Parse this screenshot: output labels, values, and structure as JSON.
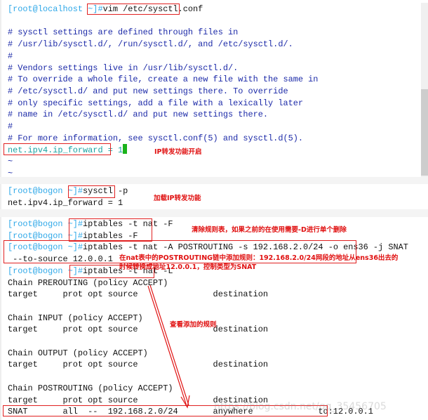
{
  "colors": {
    "prompt": "#2fa8e8",
    "comment": "#1c2aa8",
    "setting": "#1aa3a3",
    "annotation": "#e01010",
    "cursor": "#1bb31b"
  },
  "panels": [
    {
      "lines": [
        {
          "prompt": "[root@localhost ~]#",
          "cmd": "vim /etc/sysctl.conf"
        },
        {
          "text": ""
        },
        {
          "comment": "# sysctl settings are defined through files in"
        },
        {
          "comment": "# /usr/lib/sysctl.d/, /run/sysctl.d/, and /etc/sysctl.d/."
        },
        {
          "comment": "#"
        },
        {
          "comment": "# Vendors settings live in /usr/lib/sysctl.d/."
        },
        {
          "comment": "# To override a whole file, create a new file with the same in"
        },
        {
          "comment": "# /etc/sysctl.d/ and put new settings there. To override"
        },
        {
          "comment": "# only specific settings, add a file with a lexically later"
        },
        {
          "comment": "# name in /etc/sysctl.d/ and put new settings there."
        },
        {
          "comment": "#"
        },
        {
          "comment": "# For more information, see sysctl.conf(5) and sysctl.d(5)."
        },
        {
          "setting": "net.ipv4.ip_forward = 1",
          "cursor": true
        },
        {
          "comment": "~"
        },
        {
          "comment": "~"
        }
      ]
    },
    {
      "lines": [
        {
          "prompt": "[root@bogon ~]#",
          "cmd": "sysctl -p"
        },
        {
          "text": "net.ipv4.ip_forward = 1"
        }
      ]
    },
    {
      "lines": [
        {
          "prompt": "[root@bogon ~]#",
          "cmd": "iptables -t nat -F"
        },
        {
          "prompt": "[root@bogon ~]#",
          "cmd": "iptables -F"
        },
        {
          "prompt": "[root@bogon ~]#",
          "cmd": "iptables -t nat -A POSTROUTING -s 192.168.2.0/24 -o ens36 -j SNAT"
        },
        {
          "text": " --to-source 12.0.0.1"
        },
        {
          "prompt": "[root@bogon ~]#",
          "cmd": "iptables -t nat -L"
        },
        {
          "text": "Chain PREROUTING (policy ACCEPT)"
        },
        {
          "text": "target     prot opt source               destination"
        },
        {
          "text": ""
        },
        {
          "text": "Chain INPUT (policy ACCEPT)"
        },
        {
          "text": "target     prot opt source               destination"
        },
        {
          "text": ""
        },
        {
          "text": "Chain OUTPUT (policy ACCEPT)"
        },
        {
          "text": "target     prot opt source               destination"
        },
        {
          "text": ""
        },
        {
          "text": "Chain POSTROUTING (policy ACCEPT)"
        },
        {
          "text": "target     prot opt source               destination"
        },
        {
          "text": "SNAT       all  --  192.168.2.0/24       anywhere             to:12.0.0.1"
        }
      ]
    }
  ],
  "annotations": {
    "ip_forward_on": "IP转发功能开启",
    "load_ip_forward": "加载IP转发功能",
    "flush_rules": "清除规则表，如果之前的在使用需要-D进行单个删除",
    "add_rule_1": "在nat表中的POSTROUTING链中添加规则：192.168.2.0/24网段的地址从ens36出去的",
    "add_rule_2": "时候转换成地址12.0.0.1，控制类型为SNAT",
    "view_rules": "查看添加的规则"
  },
  "watermark": "https://blog.csdn.net/qq_35456705"
}
